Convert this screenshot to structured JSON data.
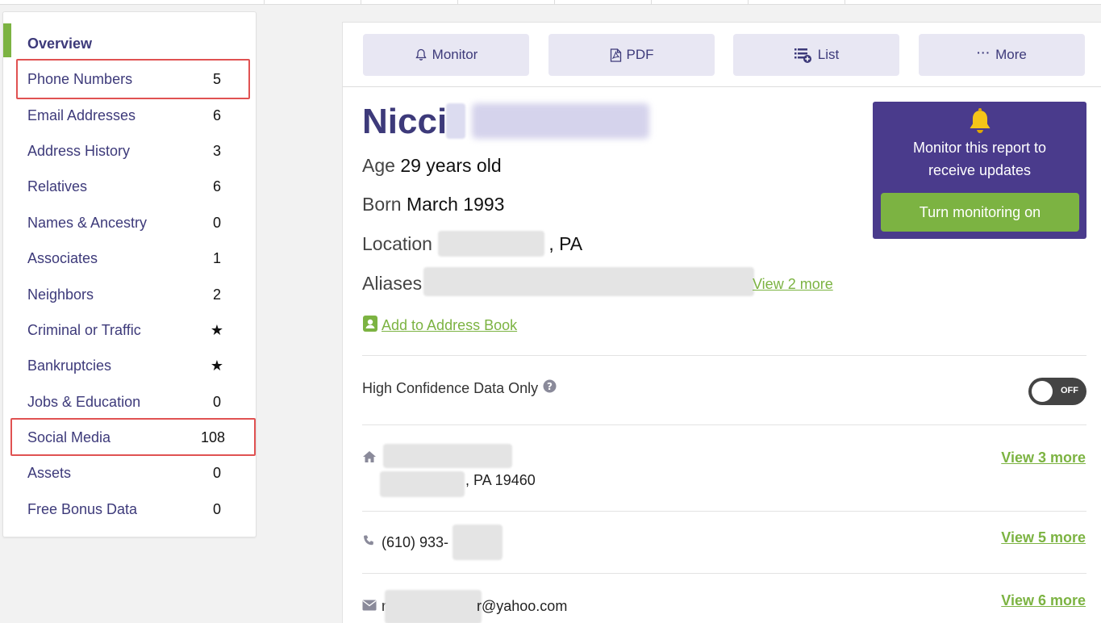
{
  "sidebar": {
    "items": [
      {
        "label": "Overview",
        "count": ""
      },
      {
        "label": "Phone Numbers",
        "count": "5"
      },
      {
        "label": "Email Addresses",
        "count": "6"
      },
      {
        "label": "Address History",
        "count": "3"
      },
      {
        "label": "Relatives",
        "count": "6"
      },
      {
        "label": "Names & Ancestry",
        "count": "0"
      },
      {
        "label": "Associates",
        "count": "1"
      },
      {
        "label": "Neighbors",
        "count": "2"
      },
      {
        "label": "Criminal or Traffic",
        "count": "★"
      },
      {
        "label": "Bankruptcies",
        "count": "★"
      },
      {
        "label": "Jobs & Education",
        "count": "0"
      },
      {
        "label": "Social Media",
        "count": "108"
      },
      {
        "label": "Assets",
        "count": "0"
      },
      {
        "label": "Free Bonus Data",
        "count": "0"
      }
    ]
  },
  "toolbar": {
    "monitor": "Monitor",
    "pdf": "PDF",
    "list": "List",
    "more": "More"
  },
  "profile": {
    "first_name": "Nicci",
    "age_label": "Age",
    "age_value": "29 years old",
    "born_label": "Born",
    "born_value": "March 1993",
    "location_label": "Location",
    "location_state": ", PA",
    "aliases_label": "Aliases",
    "aliases_link": "View 2 more",
    "add_address_book": "Add to Address Book"
  },
  "monitor_card": {
    "message_line1": "Monitor this report to",
    "message_line2": "receive updates",
    "cta": "Turn monitoring on"
  },
  "high_confidence": {
    "label": "High Confidence Data Only",
    "toggle_state": "OFF"
  },
  "records": {
    "address_line2": ", PA 19460",
    "address_more": "View 3 more",
    "phone_prefix": "(610) 933-",
    "phone_more": "View 5 more",
    "email_suffix": "r@yahoo.com",
    "email_prefix": "r",
    "email_more": "View 6 more"
  },
  "colors": {
    "brand_purple": "#3d3a7a",
    "card_purple": "#4a3b8c",
    "accent_green": "#7cb342",
    "highlight_red": "#e05252"
  }
}
